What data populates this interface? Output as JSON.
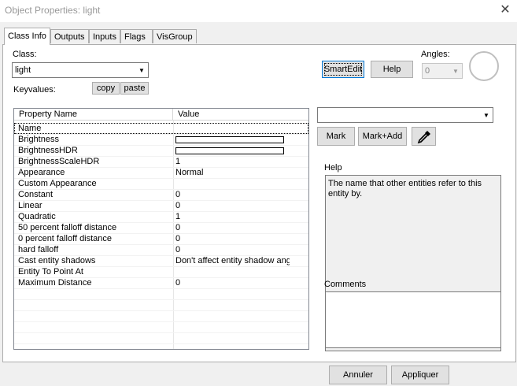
{
  "window": {
    "title": "Object Properties: light"
  },
  "tabs": [
    {
      "label": "Class Info"
    },
    {
      "label": "Outputs"
    },
    {
      "label": "Inputs"
    },
    {
      "label": "Flags"
    },
    {
      "label": "VisGroup"
    }
  ],
  "class_section": {
    "label": "Class:",
    "value": "light",
    "keyvalues_label": "Keyvalues:",
    "copy_label": "copy",
    "paste_label": "paste"
  },
  "toolbar": {
    "smartedit_label": "SmartEdit",
    "help_label": "Help",
    "angles_label": "Angles:",
    "angles_value": "0"
  },
  "table": {
    "columns": [
      "Property Name",
      "Value"
    ],
    "rows": [
      {
        "name": "Name",
        "value": ""
      },
      {
        "name": "Brightness",
        "value": "",
        "color_swatch": true
      },
      {
        "name": "BrightnessHDR",
        "value": "",
        "color_swatch": true
      },
      {
        "name": "BrightnessScaleHDR",
        "value": "1"
      },
      {
        "name": "Appearance",
        "value": "Normal"
      },
      {
        "name": "Custom Appearance",
        "value": ""
      },
      {
        "name": "Constant",
        "value": "0"
      },
      {
        "name": "Linear",
        "value": "0"
      },
      {
        "name": "Quadratic",
        "value": "1"
      },
      {
        "name": "50 percent falloff distance",
        "value": "0"
      },
      {
        "name": "0 percent falloff distance",
        "value": "0"
      },
      {
        "name": "hard falloff",
        "value": "0"
      },
      {
        "name": "Cast entity shadows",
        "value": "Don't affect entity shadow angl"
      },
      {
        "name": "Entity To Point At",
        "value": ""
      },
      {
        "name": "Maximum Distance",
        "value": "0"
      }
    ]
  },
  "right_panel": {
    "value_select": "",
    "mark_label": "Mark",
    "mark_add_label": "Mark+Add",
    "eyedropper_icon": "eyedropper-icon",
    "help_label": "Help",
    "help_text": "The name that other entities refer to this entity by.",
    "comments_label": "Comments",
    "comments_text": ""
  },
  "footer": {
    "cancel_label": "Annuler",
    "apply_label": "Appliquer"
  }
}
